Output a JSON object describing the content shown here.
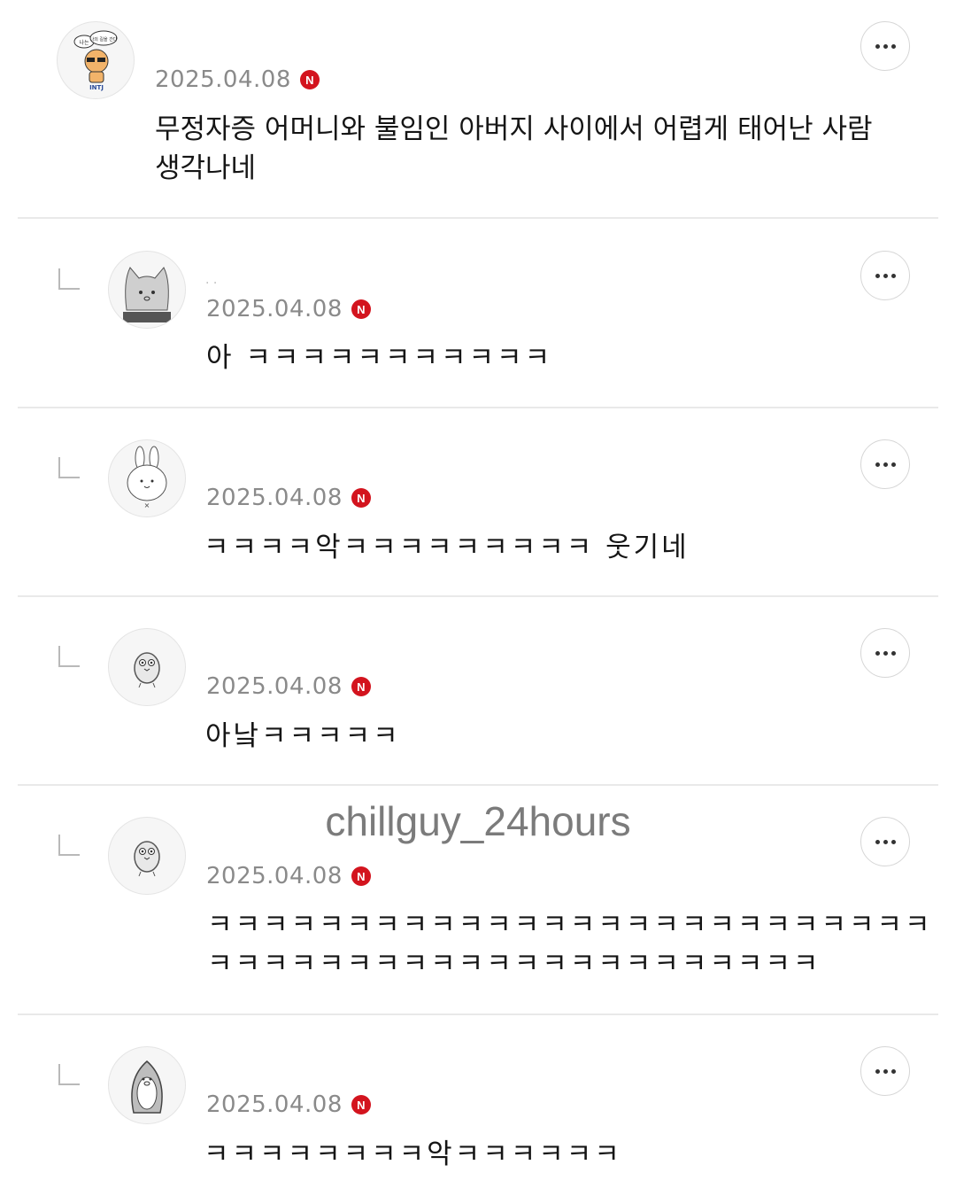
{
  "watermark": "chillguy_24hours",
  "comments": [
    {
      "date": "2025.04.08",
      "badge": "N",
      "text": "무정자증 어머니와 불임인 아버지 사이에서 어렵게 태어난 사람\n생각나네",
      "avatar_icon": "cat-sunglasses-icon",
      "avatar_text_top": "나의 길을 간다",
      "avatar_text_left": "나는",
      "avatar_text_bottom": "INTJ"
    },
    {
      "name": ". .",
      "date": "2025.04.08",
      "badge": "N",
      "text": "아 ㅋㅋㅋㅋㅋㅋㅋㅋㅋㅋㅋ",
      "avatar_icon": "cat-face-icon"
    },
    {
      "date": "2025.04.08",
      "badge": "N",
      "text": "ㅋㅋㅋㅋ악ㅋㅋㅋㅋㅋㅋㅋㅋㅋ 웃기네",
      "avatar_icon": "rabbit-icon"
    },
    {
      "date": "2025.04.08",
      "badge": "N",
      "text": "아낰ㅋㅋㅋㅋㅋ",
      "avatar_icon": "bird-icon"
    },
    {
      "date": "2025.04.08",
      "badge": "N",
      "text": "ㅋㅋㅋㅋㅋㅋㅋㅋㅋㅋㅋㅋㅋㅋㅋㅋㅋㅋㅋㅋㅋㅋㅋㅋㅋㅋ\nㅋㅋㅋㅋㅋㅋㅋㅋㅋㅋㅋㅋㅋㅋㅋㅋㅋㅋㅋㅋㅋㅋ",
      "avatar_icon": "bird-icon"
    },
    {
      "date": "2025.04.08",
      "badge": "N",
      "text": "ㅋㅋㅋㅋㅋㅋㅋㅋ악ㅋㅋㅋㅋㅋㅋ",
      "avatar_icon": "penguin-icon"
    }
  ]
}
